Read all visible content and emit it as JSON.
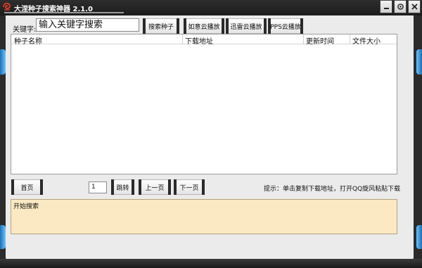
{
  "window": {
    "title": "大涅种子搜索神器 2.1.0"
  },
  "titlebar": {
    "icons": [
      "app-logo-icon",
      "minimize-icon",
      "settings-icon",
      "close-icon"
    ]
  },
  "search": {
    "label": "关键字:",
    "input_value": "输入关键字搜索",
    "search_button": "搜索种子"
  },
  "players": {
    "ruyi": "如意云播放",
    "xunlei": "迅雷云播放",
    "pps": "PPS云播放"
  },
  "table": {
    "columns": [
      "种子名称",
      "下载地址",
      "更新时间",
      "文件大小"
    ],
    "rows": []
  },
  "pagination": {
    "first": "首页",
    "page_value": "1",
    "jump": "跳转",
    "prev": "上一页",
    "next": "下一页"
  },
  "hint": "提示：单击复制下载地址，打开QQ旋风粘贴下载",
  "log": {
    "text": "开始搜索"
  },
  "colors": {
    "frame": "#2b2b2b",
    "client": "#ebebeb",
    "log_bg": "#fbe9c3",
    "accent_glow": "#3d9be8"
  }
}
